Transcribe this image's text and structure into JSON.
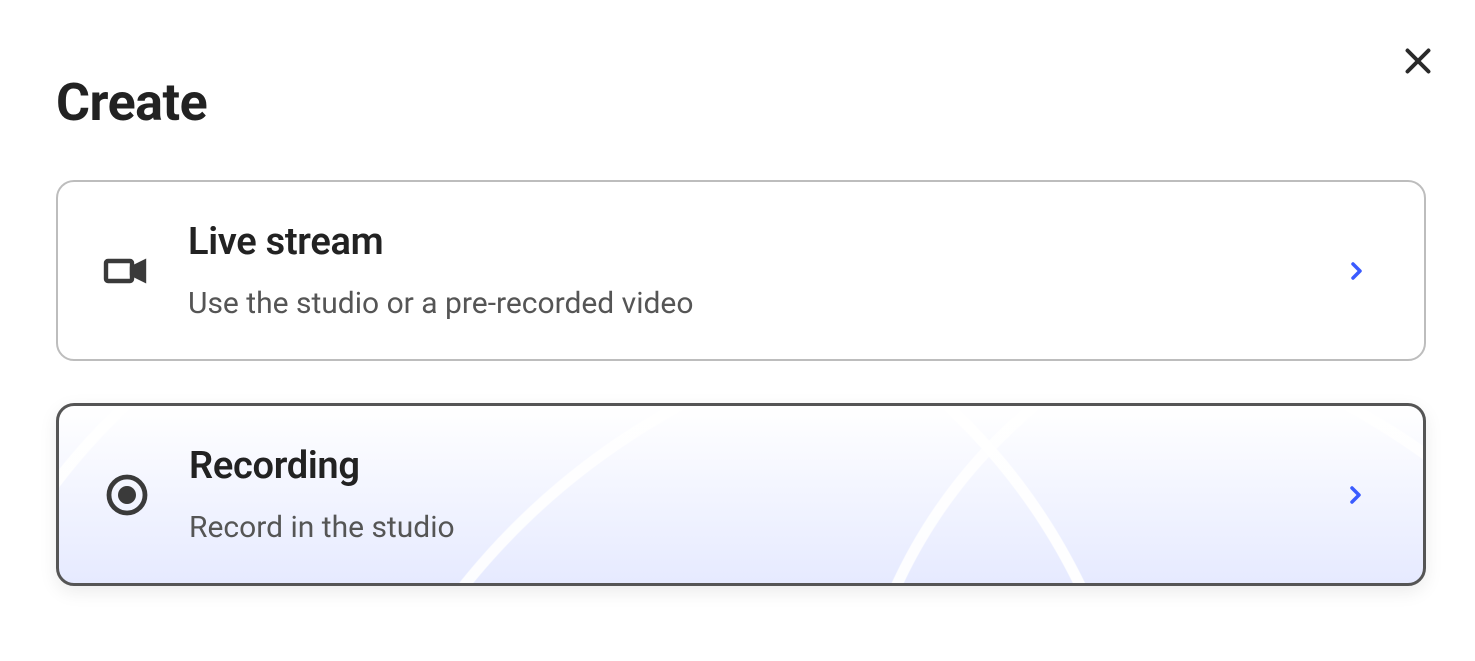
{
  "header": {
    "title": "Create"
  },
  "options": [
    {
      "icon": "video-camera-icon",
      "title": "Live stream",
      "description": "Use the studio or a pre-recorded video",
      "selected": false
    },
    {
      "icon": "record-icon",
      "title": "Recording",
      "description": "Record in the studio",
      "selected": true
    }
  ]
}
